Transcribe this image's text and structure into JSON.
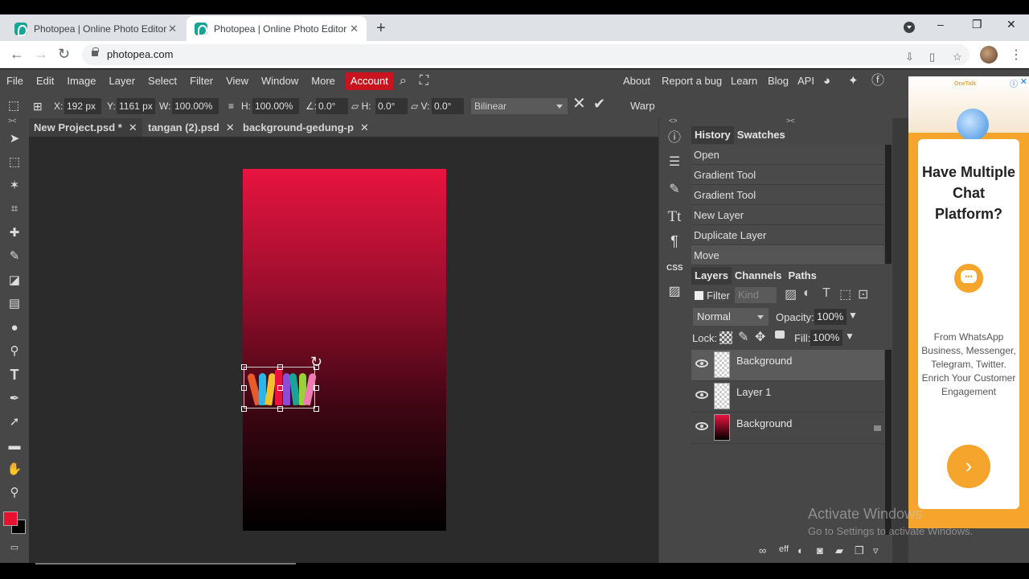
{
  "browser": {
    "tabs": [
      {
        "title": "Photopea | Online Photo Editor",
        "close": "✕"
      },
      {
        "title": "Photopea | Online Photo Editor",
        "close": "✕"
      }
    ],
    "new_tab": "+",
    "url": "photopea.com",
    "window_controls": {
      "minimize": "–",
      "restore": "❐",
      "close": "✕"
    }
  },
  "menu": {
    "items": [
      "File",
      "Edit",
      "Image",
      "Layer",
      "Select",
      "Filter",
      "View",
      "Window",
      "More"
    ],
    "account": "Account",
    "right_links": [
      "About",
      "Report a bug",
      "Learn",
      "Blog",
      "API"
    ]
  },
  "options": {
    "x_label": "X:",
    "x_value": "192 px",
    "y_label": "Y:",
    "y_value": "1161 px",
    "w_label": "W:",
    "w_value": "100.00%",
    "link": "≡",
    "h_label": "H:",
    "h_value": "100.00%",
    "angle_label": "∠:",
    "angle_value": "0.0°",
    "hskew_label": "▱ H:",
    "hskew_value": "0.0°",
    "vskew_label": "▱ V:",
    "vskew_value": "0.0°",
    "interpolation": "Bilinear",
    "cancel": "✕",
    "commit": "✔",
    "warp": "Warp"
  },
  "documents": {
    "tabs": [
      {
        "name": "New Project.psd *",
        "close": "✕"
      },
      {
        "name": "tangan (2).psd",
        "close": "✕"
      },
      {
        "name": "background-gedung-p",
        "close": "✕"
      }
    ]
  },
  "panel_toggles": {
    "left": "><",
    "center": "<>",
    "right": "><"
  },
  "history": {
    "tabs": [
      "History",
      "Swatches"
    ],
    "items": [
      "Open",
      "Gradient Tool",
      "Gradient Tool",
      "New Layer",
      "Duplicate Layer",
      "Move"
    ]
  },
  "layers": {
    "tabs": [
      "Layers",
      "Channels",
      "Paths"
    ],
    "filter_label": "Filter",
    "kind_placeholder": "Kind",
    "blend_mode": "Normal",
    "opacity_label": "Opacity:",
    "opacity_value": "100%",
    "lock_label": "Lock:",
    "fill_label": "Fill:",
    "fill_value": "100%",
    "items": [
      {
        "name": "Background",
        "selected": true
      },
      {
        "name": "Layer 1",
        "selected": false
      },
      {
        "name": "Background",
        "selected": false,
        "locked": true
      }
    ],
    "footer_icons": [
      "link-icon",
      "effects-icon",
      "adjustment-icon",
      "mask-icon",
      "folder-icon",
      "new-layer-icon",
      "trash-icon"
    ],
    "effects_label": "eff"
  },
  "side_icons": {
    "css": "CSS"
  },
  "ad": {
    "brand": "OneTalk",
    "title": "Have Multiple Chat Platform?",
    "body": "From WhatsApp Business, Messenger, Telegram, Twitter. Enrich Your Customer Engagement",
    "cta": "›"
  },
  "watermark": {
    "line1": "Activate Windows",
    "line2": "Go to Settings to activate Windows."
  },
  "colors": {
    "foreground": "#e8102f",
    "background": "#000000",
    "accent": "#c8141f"
  }
}
